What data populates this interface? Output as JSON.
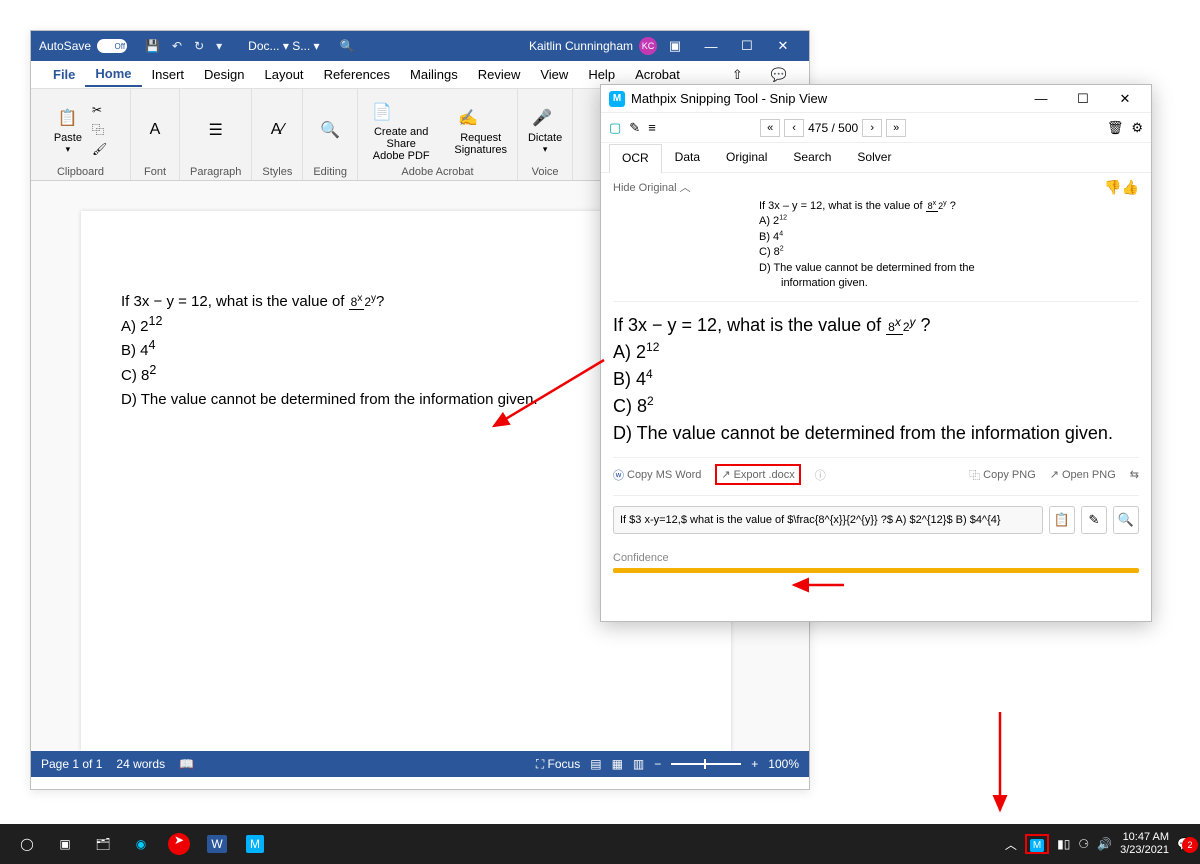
{
  "word": {
    "titlebar": {
      "autosave": "AutoSave",
      "autosave_state": "Off",
      "doc_title": "Doc...  ▾  S...  ▾",
      "user_name": "Kaitlin Cunningham",
      "user_initials": "KC"
    },
    "tabs": [
      "File",
      "Home",
      "Insert",
      "Design",
      "Layout",
      "References",
      "Mailings",
      "Review",
      "View",
      "Help",
      "Acrobat"
    ],
    "active_tab": "Home",
    "ribbon": {
      "clipboard": "Clipboard",
      "paste": "Paste",
      "font": "Font",
      "paragraph": "Paragraph",
      "styles": "Styles",
      "editing": "Editing",
      "create_share": "Create and Share",
      "adobe_pdf": "Adobe PDF",
      "request": "Request",
      "signatures": "Signatures",
      "adobe_acrobat": "Adobe Acrobat",
      "dictate": "Dictate",
      "voice": "Voice"
    },
    "document": {
      "question": "If 3x − y = 12, what is the value of ",
      "frac_top": "8",
      "frac_top_sup": "x",
      "frac_bot": "2",
      "frac_bot_sup": "y",
      "qmark": "?",
      "a": "A) 2",
      "a_sup": "12",
      "b": "B) 4",
      "b_sup": "4",
      "c": "C) 8",
      "c_sup": "2",
      "d": "D) The value cannot be determined from the information given."
    },
    "status": {
      "page": "Page 1 of 1",
      "words": "24 words",
      "focus": "Focus",
      "zoom": "100%"
    }
  },
  "mathpix": {
    "title": "Mathpix Snipping Tool - Snip View",
    "nav_count": "475 / 500",
    "tabs": [
      "OCR",
      "Data",
      "Original",
      "Search",
      "Solver"
    ],
    "active_tab": "OCR",
    "hide_original": "Hide Original",
    "original": {
      "q": "If 3x – y = 12, what is the value of ",
      "a": "A)  2",
      "a_sup": "12",
      "b": "B)  4",
      "b_sup": "4",
      "c": "C)  8",
      "c_sup": "2",
      "d1": "D)  The value cannot be determined from the",
      "d2": "information given."
    },
    "render": {
      "q": "If 3x − y = 12, what is the value of ",
      "a": "A) 2",
      "a_sup": "12",
      "b": "B) 4",
      "b_sup": "4",
      "c": "C) 8",
      "c_sup": "2",
      "d": "D) The value cannot be determined from the information given."
    },
    "exports": {
      "copy_word": "Copy MS Word",
      "export_docx": "Export .docx",
      "copy_png": "Copy PNG",
      "open_png": "Open PNG"
    },
    "latex": "If $3 x-y=12,$ what is the value of $\\frac{8^{x}}{2^{y}} ?$ A) $2^{12}$ B) $4^{4}",
    "confidence": "Confidence"
  },
  "taskbar": {
    "time": "10:47 AM",
    "date": "3/23/2021",
    "notif_count": "2"
  }
}
